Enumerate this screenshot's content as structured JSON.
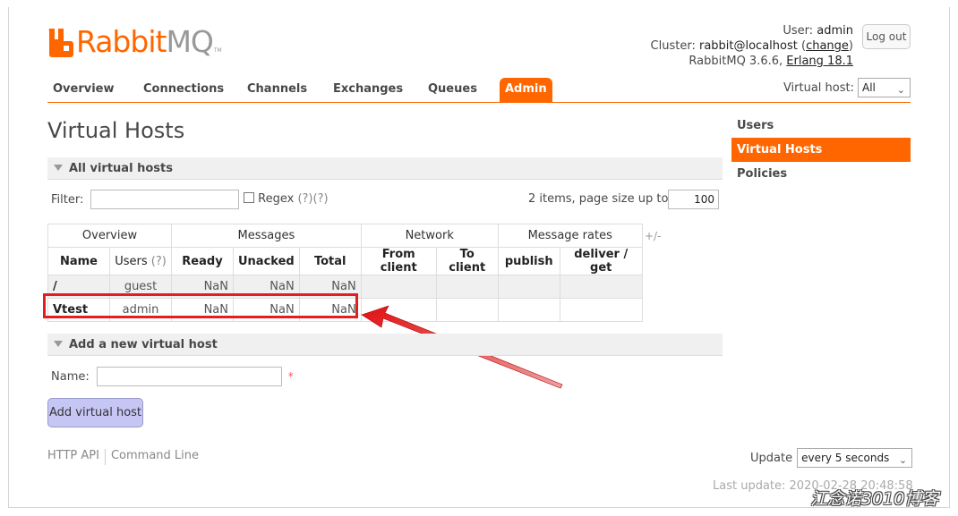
{
  "brand": {
    "logo_text_1": "Rabbit",
    "logo_text_2": "MQ",
    "logo_tm": "TM",
    "accent": "#ff6600"
  },
  "userinfo": {
    "user_label": "User:",
    "user": "admin",
    "cluster_label": "Cluster:",
    "cluster": "rabbit@localhost",
    "change_link": "change",
    "version": "RabbitMQ 3.6.6,",
    "erlang": "Erlang 18.1",
    "logout": "Log out"
  },
  "nav": {
    "tabs": [
      "Overview",
      "Connections",
      "Channels",
      "Exchanges",
      "Queues",
      "Admin"
    ],
    "active": "Admin",
    "vhost_label": "Virtual host:",
    "vhost_value": "All"
  },
  "page_title": "Virtual Hosts",
  "sidebar": {
    "items": [
      "Users",
      "Virtual Hosts",
      "Policies"
    ],
    "active": "Virtual Hosts"
  },
  "all_vhosts": {
    "heading": "All virtual hosts",
    "filter_label": "Filter:",
    "regex_label": "Regex",
    "regex_help": "(?)(?)",
    "items_text": "2 items, page size up to",
    "page_size": "100",
    "plus_minus": "+/-",
    "group_headers": [
      "Overview",
      "Messages",
      "Network",
      "Message rates"
    ],
    "columns": [
      "Name",
      "Users",
      "(?)",
      "Ready",
      "Unacked",
      "Total",
      "From client",
      "To client",
      "publish",
      "deliver / get"
    ],
    "rows": [
      {
        "name": "/",
        "users": "guest",
        "ready": "NaN",
        "unacked": "NaN",
        "total": "NaN"
      },
      {
        "name": "Vtest",
        "users": "admin",
        "ready": "NaN",
        "unacked": "NaN",
        "total": "NaN"
      }
    ]
  },
  "add_vhost": {
    "heading": "Add a new virtual host",
    "name_label": "Name:",
    "required_mark": "*",
    "button": "Add virtual host"
  },
  "footer": {
    "http_api": "HTTP API",
    "command_line": "Command Line",
    "update_label": "Update",
    "update_value": "every 5 seconds",
    "last_update": "Last update: 2020-02-28 20:48:58"
  },
  "watermark": "江念诺3010博客",
  "colors": {
    "highlight": "#e02020",
    "button_bg": "#c6c6f5"
  }
}
